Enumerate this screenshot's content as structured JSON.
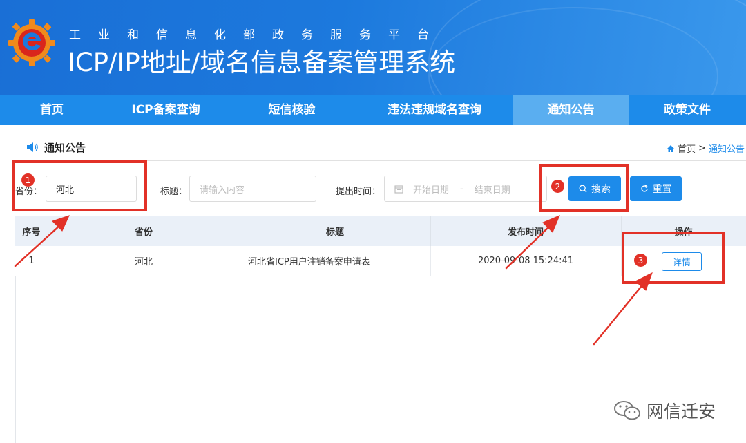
{
  "header": {
    "subtitle": "工业和信息化部政务服务平台",
    "title": "ICP/IP地址/域名信息备案管理系统"
  },
  "nav": [
    {
      "label": "首页"
    },
    {
      "label": "ICP备案查询"
    },
    {
      "label": "短信核验"
    },
    {
      "label": "违法违规域名查询"
    },
    {
      "label": "通知公告"
    },
    {
      "label": "政策文件"
    }
  ],
  "page": {
    "title": "通知公告",
    "breadcrumb_home": "首页",
    "breadcrumb_sep": ">",
    "breadcrumb_current": "通知公告"
  },
  "filters": {
    "province_label": "省份：",
    "province_value": "河北",
    "title_label": "标题：",
    "title_placeholder": "请输入内容",
    "time_label": "提出时间：",
    "start_placeholder": "开始日期",
    "range_sep": "-",
    "end_placeholder": "结束日期",
    "search_label": "搜索",
    "reset_label": "重置"
  },
  "table": {
    "headers": [
      "序号",
      "省份",
      "标题",
      "发布时间",
      "操作"
    ],
    "rows": [
      {
        "index": "1",
        "province": "河北",
        "title": "河北省ICP用户注销备案申请表",
        "time": "2020-09-08 15:24:41",
        "action": "详情"
      }
    ]
  },
  "annotations": {
    "badge1": "1",
    "badge2": "2",
    "badge3": "3",
    "color": "#e23127"
  },
  "watermark": "网信迁安",
  "colors": {
    "primary": "#1d8bea",
    "nav_active": "#5aaef0",
    "annotation": "#e23127"
  }
}
